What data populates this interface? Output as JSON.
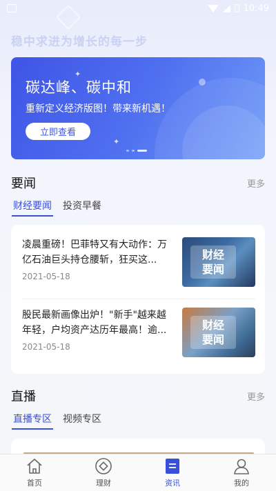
{
  "status_bar": {
    "time": "10:49"
  },
  "slogan": "稳中求进为增长的每一步",
  "banner": {
    "title": "碳达峰、碳中和",
    "subtitle": "重新定义经济版图！带来新机遇！",
    "button_label": "立即查看"
  },
  "news_section": {
    "title": "要闻",
    "more_label": "更多",
    "tabs": [
      {
        "label": "财经要闻",
        "active": true
      },
      {
        "label": "投资早餐",
        "active": false
      }
    ],
    "items": [
      {
        "title": "凌晨重磅！巴菲特又有大动作：万亿石油巨头持仓腰斩，狂买这...",
        "date": "2021-05-18",
        "thumb_label_line1": "财经",
        "thumb_label_line2": "要闻"
      },
      {
        "title": "股民最新画像出炉！\"新手\"越来越年轻，户均资产达历年最高！逾...",
        "date": "2021-05-18",
        "thumb_label_line1": "财经",
        "thumb_label_line2": "要闻"
      }
    ]
  },
  "live_section": {
    "title": "直播",
    "more_label": "更多",
    "tabs": [
      {
        "label": "直播专区",
        "active": true
      },
      {
        "label": "视频专区",
        "active": false
      }
    ]
  },
  "tabbar": {
    "items": [
      {
        "label": "首页",
        "icon": "home-icon",
        "active": false
      },
      {
        "label": "理财",
        "icon": "wealth-icon",
        "active": false
      },
      {
        "label": "资讯",
        "icon": "news-icon",
        "active": true
      },
      {
        "label": "我的",
        "icon": "profile-icon",
        "active": false
      }
    ]
  },
  "colors": {
    "accent": "#3a4fd8",
    "banner_start": "#3f55e6",
    "banner_end": "#6f9cf7"
  }
}
